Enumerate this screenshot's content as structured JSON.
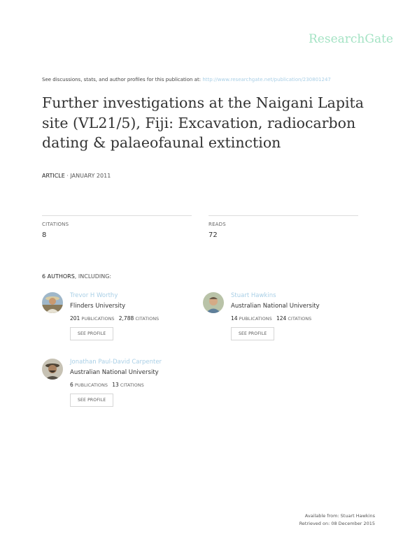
{
  "logo": "ResearchGate",
  "discuss": {
    "prefix": "See discussions, stats, and author profiles for this publication at:",
    "url": "http://www.researchgate.net/publication/230801247"
  },
  "title": "Further investigations at the Naigani Lapita site (VL21/5), Fiji: Excavation, radiocarbon dating & palaeofaunal extinction",
  "meta": {
    "type": "ARTICLE",
    "sep": " · ",
    "date": "JANUARY 2011"
  },
  "stats": {
    "citations_label": "CITATIONS",
    "citations_value": "8",
    "reads_label": "READS",
    "reads_value": "72"
  },
  "authors_heading": {
    "count": "6 AUTHORS",
    "suffix": ", INCLUDING:"
  },
  "authors": [
    {
      "name": "Trevor H Worthy",
      "institution": "Flinders University",
      "publications": "201",
      "citations": "2,788"
    },
    {
      "name": "Stuart Hawkins",
      "institution": "Australian National University",
      "publications": "14",
      "citations": "124"
    },
    {
      "name": "Jonathan Paul-David Carpenter",
      "institution": "Australian National University",
      "publications": "6",
      "citations": "13"
    }
  ],
  "labels": {
    "publications": "PUBLICATIONS",
    "citations": "CITATIONS",
    "see_profile": "SEE PROFILE"
  },
  "footer": {
    "available": "Available from: Stuart Hawkins",
    "retrieved": "Retrieved on: 08 December 2015"
  },
  "colors": {
    "logo": "#a4e3c4",
    "link": "#a9cfe6"
  }
}
